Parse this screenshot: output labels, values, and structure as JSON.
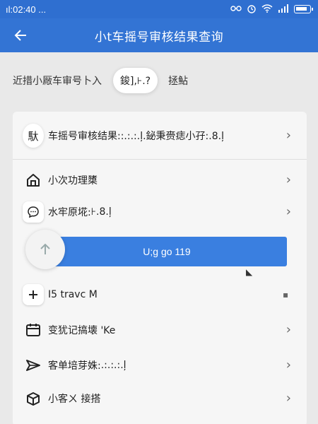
{
  "status_bar": {
    "time": "ıl:02:40 ...",
    "icons": [
      "link-icon",
      "alarm-icon",
      "wifi-icon",
      "signal-icon",
      "battery-icon"
    ]
  },
  "app_bar": {
    "back_icon": "arrow-left-icon",
    "title": "小t车摇号审核结果查询"
  },
  "notice": {
    "text_left": "近措小厰车审号卜入",
    "text_right": "拯鮎",
    "tooltip": "鋑],⊦.?"
  },
  "rows": [
    {
      "icon": "user-icon",
      "icon_glyph": "馱",
      "label": "车摇号审核结果:",
      "label_tail": ":.:.:.ļ.鉍秉赍痣小孖:.8.ļ"
    },
    {
      "icon": "house-icon",
      "label": "小次功理橥"
    },
    {
      "icon": "chat-icon",
      "label": "水牢原埖:",
      "label_tail": "⊦.8.ļ"
    },
    {
      "icon": "plus-icon",
      "label": "I5 travc M"
    },
    {
      "icon": "calendar-icon",
      "label": "变犹记搞壊 'Ke"
    },
    {
      "icon": "send-icon",
      "label": "客单培芽姝:",
      "label_tail": ".:.:.:.ļ"
    },
    {
      "icon": "box-icon",
      "label": "小客ㄨ 接搭"
    }
  ],
  "action_button": {
    "label": "U;g go 119"
  },
  "colors": {
    "primary": "#3374d4",
    "status_bar": "#2f6fd0",
    "button": "#3a7fe0",
    "background": "#e9e9e9",
    "card": "#f6f6f6",
    "accent_gold": "#c9a100"
  }
}
